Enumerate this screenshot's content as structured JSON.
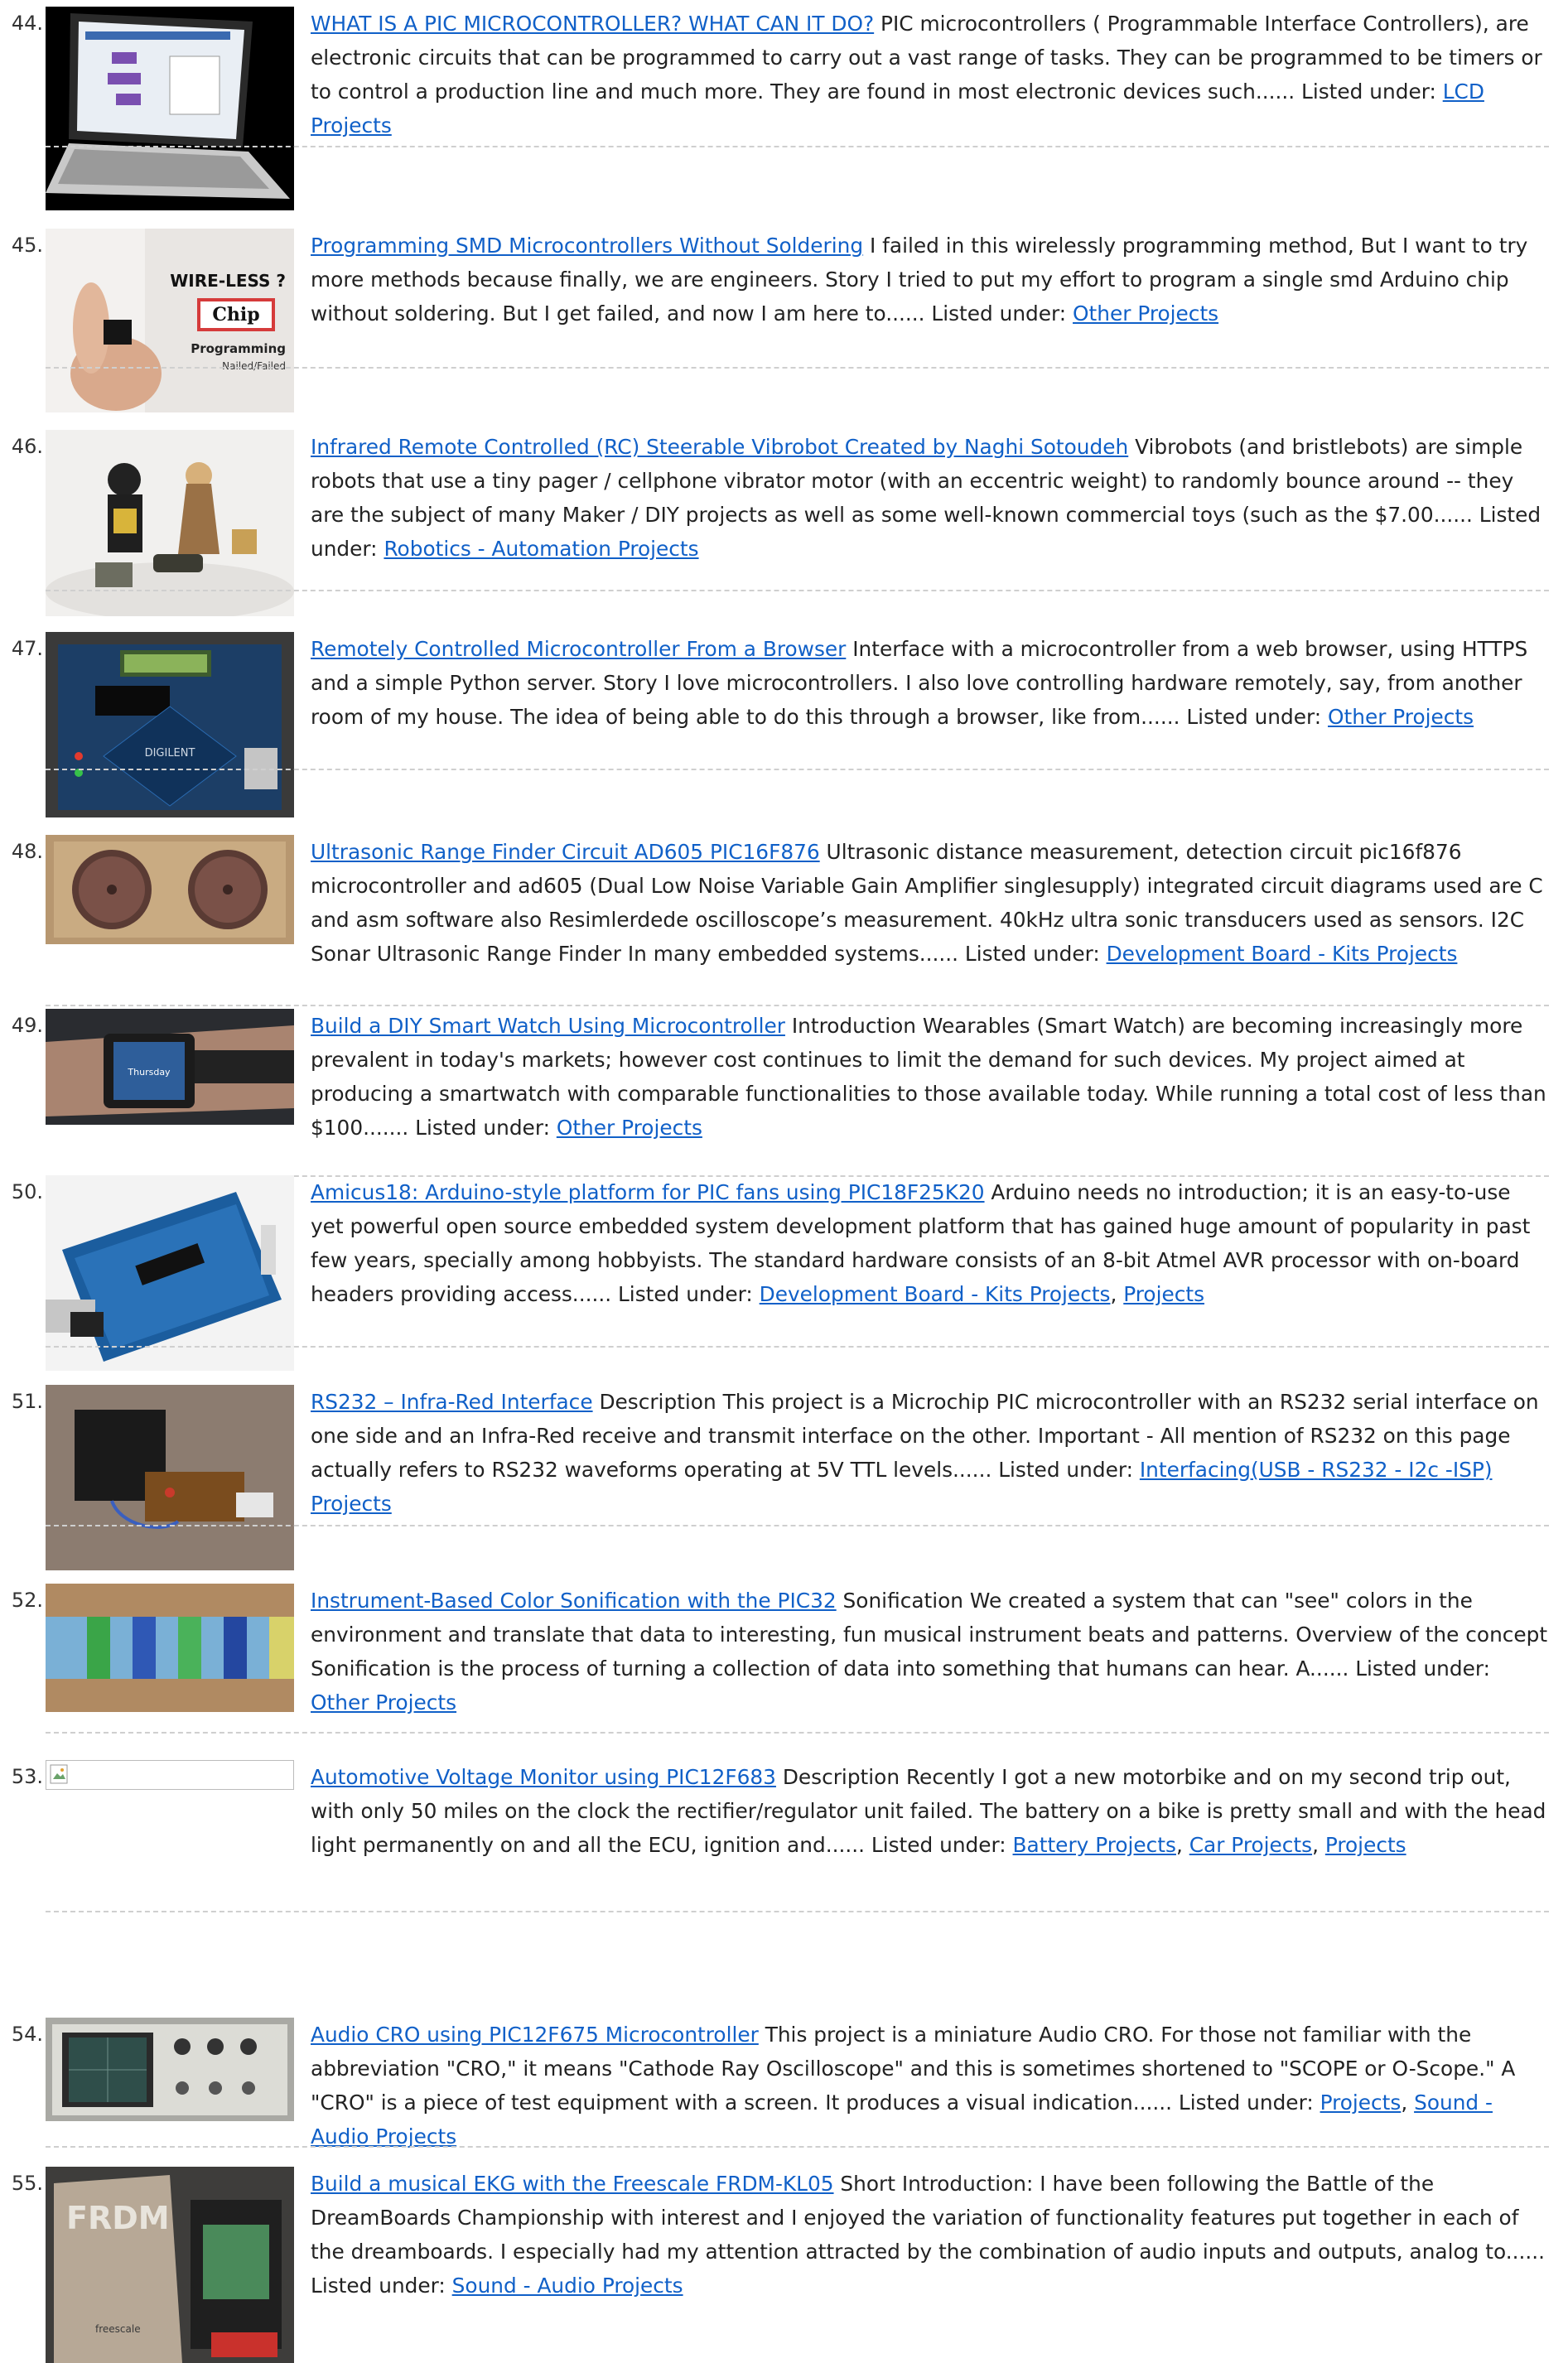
{
  "items": [
    {
      "number": "44.",
      "title": "WHAT IS A PIC MICROCONTROLLER? WHAT CAN IT DO?",
      "description": " PIC microcontrollers ( Programmable Interface Controllers), are electronic circuits that can be programmed to carry out a vast range of tasks. They can be programmed to be timers or to control a production line and much more. They are found in most electronic devices such...... Listed under: ",
      "categories": [
        "LCD Projects"
      ],
      "thumbnail": "laptop-with-flowchart-icon"
    },
    {
      "number": "45.",
      "title": "Programming SMD Microcontrollers Without Soldering",
      "description": " I failed in this wirelessly programming method, But I want to try more methods because finally, we are engineers. Story I tried to put my effort to program a single smd Arduino chip without soldering. But I get failed, and now I am here to...... Listed under: ",
      "categories": [
        "Other Projects"
      ],
      "thumbnail": "wireless-chip-icon",
      "thumb_text": {
        "line1": "WIRE-LESS ?",
        "line2": "Chip",
        "line3": "Programming",
        "line4": "Nailed/Failed"
      }
    },
    {
      "number": "46.",
      "title": "Infrared Remote Controlled (RC) Steerable Vibrobot Created by Naghi Sotoudeh",
      "description": " Vibrobots (and bristlebots) are simple robots that use a tiny pager / cellphone vibrator motor (with an eccentric weight) to randomly bounce around -- they are the subject of many Maker / DIY projects as well as some well-known commercial toys (such as the $7.00...... Listed under: ",
      "categories": [
        "Robotics - Automation Projects"
      ],
      "thumbnail": "vibrobot-figures-icon"
    },
    {
      "number": "47.",
      "title": "Remotely Controlled Microcontroller From a Browser",
      "description": " Interface with a microcontroller from a web browser, using HTTPS and a simple Python server. Story I love microcontrollers. I also love controlling hardware remotely, say, from another room of my house. The idea of being able to do this through a browser, like from...... Listed under: ",
      "categories": [
        "Other Projects"
      ],
      "thumbnail": "dev-board-icon",
      "thumb_text": {
        "brand": "DIGILENT"
      }
    },
    {
      "number": "48.",
      "title": "Ultrasonic Range Finder Circuit AD605 PIC16F876",
      "description": " Ultrasonic distance measurement, detection circuit pic16f876 microcontroller and ad605 (Dual Low Noise Variable Gain Amplifier singlesupply) integrated circuit diagrams used are C and asm software also Resimlerdede oscilloscope’s measurement. 40kHz ultra sonic transducers used as sensors. I2C Sonar Ultrasonic Range Finder In many embedded systems...... Listed under: ",
      "categories": [
        "Development Board - Kits Projects"
      ],
      "thumbnail": "ultrasonic-sensor-icon"
    },
    {
      "number": "49.",
      "title": "Build a DIY Smart Watch Using Microcontroller",
      "description": " Introduction Wearables (Smart Watch) are becoming increasingly more prevalent in today's markets; however cost continues to limit the demand for such devices. My project aimed at producing a smartwatch with comparable functionalities to those available today. While running a total cost of less than $100....... Listed under: ",
      "categories": [
        "Other Projects"
      ],
      "thumbnail": "smartwatch-icon",
      "thumb_text": {
        "watch": "Thursday"
      }
    },
    {
      "number": "50.",
      "title": "Amicus18: Arduino-style platform for PIC fans using PIC18F25K20",
      "description": " Arduino needs no introduction; it is an easy-to-use yet powerful open source embedded system development platform that has gained huge amount of popularity in past few years, specially among hobbyists. The standard hardware consists of an 8-bit Atmel AVR processor with on-board headers providing access...... Listed under: ",
      "categories": [
        "Development Board - Kits Projects",
        "Projects"
      ],
      "thumbnail": "arduino-board-icon"
    },
    {
      "number": "51.",
      "title": "RS232 – Infra-Red Interface",
      "description": " Description This project is a Microchip PIC microcontroller with an RS232 serial interface on one side and an Infra-Red receive and transmit interface on the other. Important - All mention of RS232 on this page actually refers to RS232 waveforms operating at 5V TTL levels...... Listed under: ",
      "categories": [
        "Interfacing(USB - RS232 - I2c -ISP) Projects"
      ],
      "thumbnail": "ir-interface-icon"
    },
    {
      "number": "52.",
      "title": "Instrument-Based Color Sonification with the PIC32",
      "description": " Sonification We created a system that can \"see\" colors in the environment and translate that data to interesting, fun musical instrument beats and patterns. Overview of the concept Sonification is the process of turning a collection of data into something that humans can hear. A...... Listed under: ",
      "categories": [
        "Other Projects"
      ],
      "thumbnail": "color-wheel-icon"
    },
    {
      "number": "53.",
      "title": "Automotive Voltage Monitor using PIC12F683",
      "description": " Description Recently I got a new motorbike and on my second trip out, with only 50 miles on the clock the rectifier/regulator unit failed.  The battery on a bike is pretty small and with the head light permanently on and all the ECU, ignition and...... Listed under: ",
      "categories": [
        "Battery Projects",
        "Car Projects",
        "Projects"
      ],
      "thumbnail": "broken-image-icon"
    },
    {
      "number": "54.",
      "title": "Audio CRO using PIC12F675 Microcontroller",
      "description": " This project is a miniature Audio CRO. For those not familiar with the abbreviation \"CRO,\" it means \"Cathode Ray Oscilloscope\" and this is sometimes shortened to \"SCOPE or O-Scope.\" A \"CRO\" is a piece of test equipment with a screen. It produces a visual indication...... Listed under: ",
      "categories": [
        "Projects",
        "Sound - Audio Projects"
      ],
      "thumbnail": "oscilloscope-icon"
    },
    {
      "number": "55.",
      "title": "Build a musical EKG with the Freescale FRDM-KL05",
      "description": " Short Introduction: I have been following the Battle of the DreamBoards Championship with interest and I enjoyed the variation of functionality features put together in each of the dreamboards.  I especially had my attention attracted by the combination of audio inputs and outputs, analog to...... Listed under: ",
      "categories": [
        "Sound - Audio Projects"
      ],
      "thumbnail": "frdm-board-icon",
      "thumb_text": {
        "brand": "FRDM",
        "maker": "freescale"
      }
    }
  ]
}
